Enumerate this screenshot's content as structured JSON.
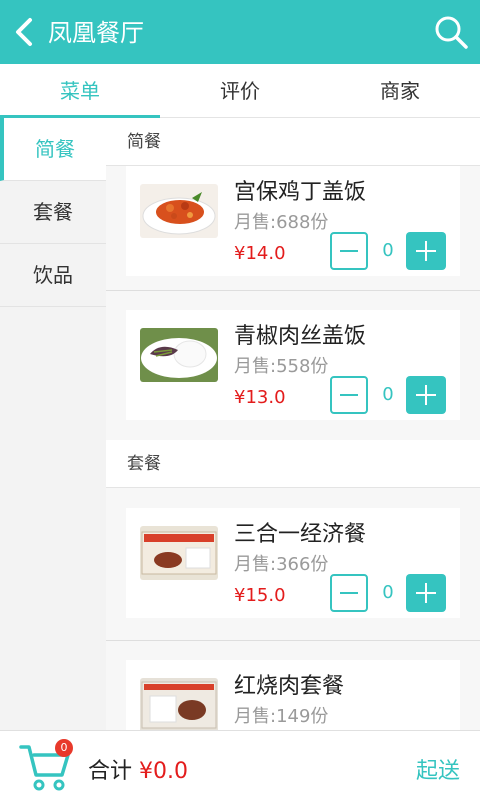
{
  "header": {
    "title": "凤凰餐厅",
    "back_icon": "back-chevron-icon",
    "search_icon": "search-icon",
    "color": "#35c4c0"
  },
  "tabs": [
    {
      "label": "菜单",
      "active": true
    },
    {
      "label": "评价",
      "active": false
    },
    {
      "label": "商家",
      "active": false
    }
  ],
  "sidebar": {
    "items": [
      {
        "label": "简餐",
        "active": true
      },
      {
        "label": "套餐",
        "active": false
      },
      {
        "label": "饮品",
        "active": false
      }
    ]
  },
  "menu": {
    "sections": [
      {
        "title": "简餐",
        "dishes": [
          {
            "name": "宫保鸡丁盖饭",
            "sales": "月售:688份",
            "price": "¥14.0",
            "qty": "0"
          },
          {
            "name": "青椒肉丝盖饭",
            "sales": "月售:558份",
            "price": "¥13.0",
            "qty": "0"
          }
        ]
      },
      {
        "title": "套餐",
        "dishes": [
          {
            "name": "三合一经济餐",
            "sales": "月售:366份",
            "price": "¥15.0",
            "qty": "0"
          },
          {
            "name": "红烧肉套餐",
            "sales": "月售:149份",
            "price": "",
            "qty": ""
          }
        ]
      }
    ]
  },
  "footer": {
    "cart_count": "0",
    "total_label": "合计 ",
    "total_value": "¥0.0",
    "deliver_label": "起送"
  },
  "colors": {
    "accent": "#35c4c0",
    "price": "#e31c1c",
    "badge": "#e8392b"
  }
}
